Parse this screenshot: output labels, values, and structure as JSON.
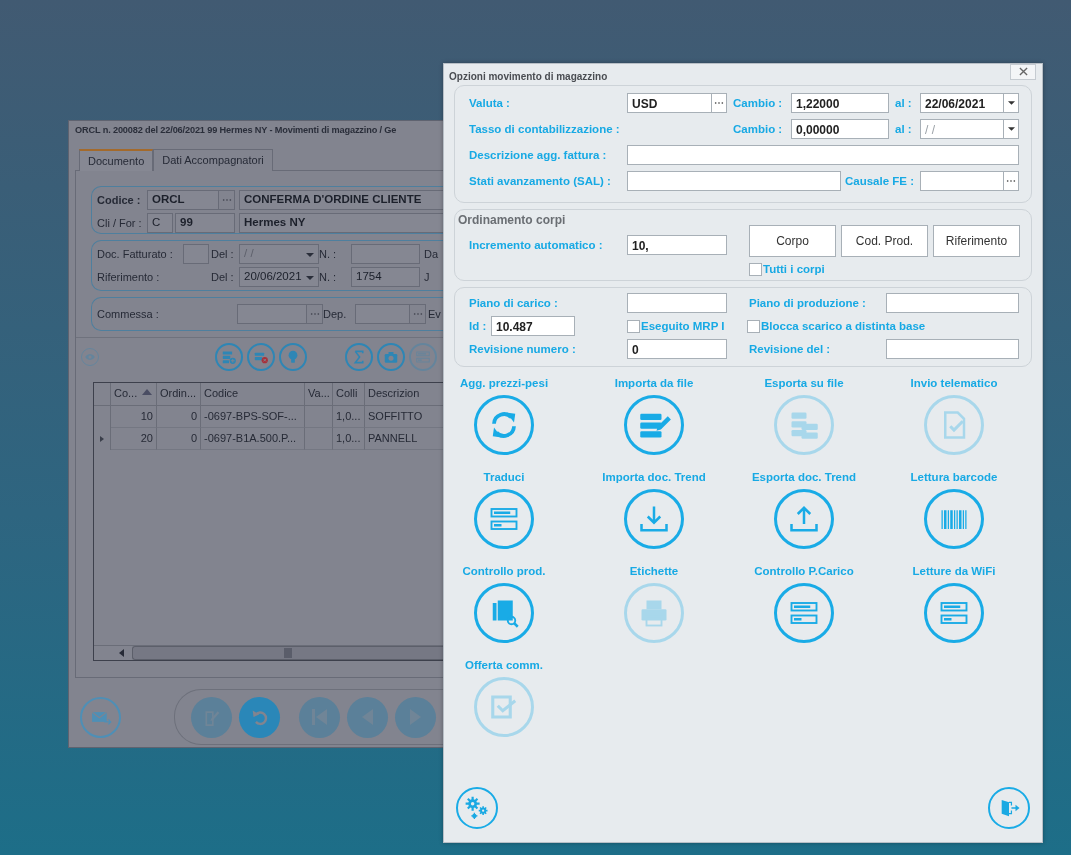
{
  "background_window": {
    "title": "ORCL n. 200082 del 22/06/2021 99 Hermes NY - Movimenti di magazzino / Ge",
    "tabs": [
      {
        "label": "Documento",
        "selected": true
      },
      {
        "label": "Dati Accompagnatori",
        "selected": false
      }
    ],
    "codice": {
      "label": "Codice :",
      "value": "ORCL",
      "description": "CONFERMA D'ORDINE CLIENTE"
    },
    "cli_for": {
      "label": "Cli / For :",
      "type": "C",
      "code": "99",
      "name": "Hermes NY"
    },
    "doc_fatturato": {
      "label": "Doc. Fatturato :",
      "del_label": "Del :",
      "date": "/ /",
      "n_label": "N. :",
      "column_4": "Da"
    },
    "riferimento": {
      "label": "Riferimento :",
      "del_label": "Del :",
      "date": "20/06/2021",
      "n_label": "N. :",
      "number": "1754",
      "column_4": "J"
    },
    "commessa": {
      "label": "Commessa :",
      "dep_label": "Dep.",
      "column_3": "Ev"
    },
    "toolbar": [
      {
        "disabled": true
      },
      {
        "disabled": false
      },
      {
        "disabled": false
      },
      {
        "disabled": false
      },
      {
        "disabled": false
      },
      {
        "disabled": false
      },
      {
        "disabled": true
      }
    ],
    "table": {
      "columns": [
        {
          "label": "Co...",
          "sorted": true
        },
        {
          "label": "Ordin...",
          "sorted": false
        },
        {
          "label": "Codice",
          "sorted": false
        },
        {
          "label": "Va...",
          "sorted": false
        },
        {
          "label": "Colli",
          "sorted": false
        },
        {
          "label": "Descrizion",
          "sorted": false
        }
      ],
      "rows": [
        {
          "current": false,
          "cells": [
            "10",
            "0",
            "-0697-BPS-SOF-...",
            "",
            "1,0...",
            "SOFFITTO"
          ]
        },
        {
          "current": true,
          "cells": [
            "20",
            "0",
            "-0697-B1A.500.P...",
            "",
            "1,0...",
            "PANNELL"
          ]
        }
      ]
    },
    "nav": [
      {
        "disabled": false
      },
      {
        "disabled": true
      },
      {
        "disabled": false
      },
      {
        "disabled": true
      },
      {
        "disabled": true
      },
      {
        "disabled": true
      }
    ]
  },
  "dialog": {
    "title": "Opzioni movimento di magazzino",
    "valuta": {
      "label": "Valuta :",
      "value": "USD",
      "cambio_label": "Cambio :",
      "cambio": "1,22000",
      "al_label": "al :",
      "date": "22/06/2021"
    },
    "tasso": {
      "label": "Tasso di contabilizzazione :",
      "cambio_label": "Cambio :",
      "cambio": "0,00000",
      "al_label": "al :",
      "date": "/ /"
    },
    "descrizione": {
      "label": "Descrizione agg. fattura :"
    },
    "sal": {
      "label": "Stati avanzamento (SAL) :",
      "causale_label": "Causale FE :"
    },
    "ordinamento": {
      "title": "Ordinamento corpi",
      "label": "Incremento automatico :",
      "value": "10,",
      "buttons": [
        "Corpo",
        "Cod. Prod.",
        "Riferimento"
      ],
      "tutti": {
        "label": "Tutti i corpi",
        "checked": false
      }
    },
    "produzione": {
      "piano_carico_label": "Piano di carico :",
      "piano_produzione_label": "Piano di produzione :",
      "id_label": "Id :",
      "id": "10.487",
      "mrp": {
        "label": "Eseguito MRP I",
        "checked": false
      },
      "blocca": {
        "label": "Blocca scarico a distinta base",
        "checked": false
      },
      "revisione_numero_label": "Revisione numero :",
      "revisione_numero": "0",
      "revisione_del_label": "Revisione del :"
    },
    "actions": [
      {
        "label": "Agg. prezzi-pesi",
        "disabled": false
      },
      {
        "label": "Importa da file",
        "disabled": false
      },
      {
        "label": "Esporta su file",
        "disabled": true
      },
      {
        "label": "Invio telematico",
        "disabled": true
      },
      {
        "label": "Traduci",
        "disabled": false
      },
      {
        "label": "Importa doc. Trend",
        "disabled": false
      },
      {
        "label": "Esporta doc. Trend",
        "disabled": false
      },
      {
        "label": "Lettura barcode",
        "disabled": false
      },
      {
        "label": "Controllo prod.",
        "disabled": false
      },
      {
        "label": "Etichette",
        "disabled": true
      },
      {
        "label": "Controllo P.Carico",
        "disabled": false
      },
      {
        "label": "Letture da WiFi",
        "disabled": false
      },
      {
        "label": "Offerta comm.",
        "disabled": true
      }
    ]
  }
}
